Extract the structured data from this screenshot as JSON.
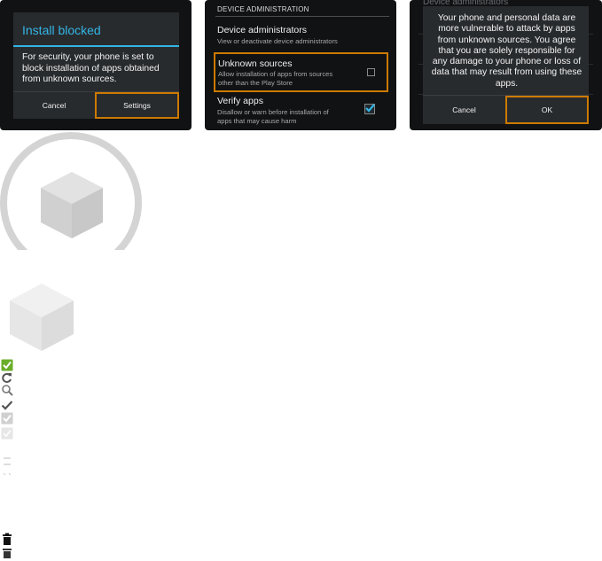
{
  "install_blocked_dialog": {
    "title": "Install blocked",
    "message": "For security, your phone is set to block installation of apps obtained from unknown sources.",
    "cancel_label": "Cancel",
    "settings_label": "Settings"
  },
  "security_settings": {
    "section_header": "DEVICE ADMINISTRATION",
    "items": [
      {
        "title": "Device administrators",
        "summary": "View or deactivate device administrators"
      },
      {
        "title": "Unknown sources",
        "summary_line1": "Allow installation of apps from sources",
        "summary_line2": "other than the Play Store",
        "checked": false
      },
      {
        "title": "Verify apps",
        "summary_line1": "Disallow or warn before installation of",
        "summary_line2": "apps that may cause harm",
        "checked": true
      }
    ]
  },
  "unknown_sources_warning": {
    "background_item": "Device administrators",
    "message": "Your phone and personal data are more vulnerable to attack by apps from unknown sources. You agree that you are solely responsible for any damage to your phone or loss of data that may result from using these apps.",
    "cancel_label": "Cancel",
    "ok_label": "OK"
  },
  "colors": {
    "accent_blue": "#33b5e5",
    "focus_orange": "#cc7a00",
    "dialog_bg": "#282b2e",
    "check_green": "#6aad2a"
  },
  "icons": [
    "package-circle-icon",
    "package-icon",
    "green-check-icon",
    "refresh-icon",
    "search-icon",
    "checkmark-icon",
    "checkbox-grey-icon",
    "checkbox-light-icon",
    "list-lines-icon",
    "divider-icon",
    "trash-icon",
    "trash-icon-small"
  ]
}
